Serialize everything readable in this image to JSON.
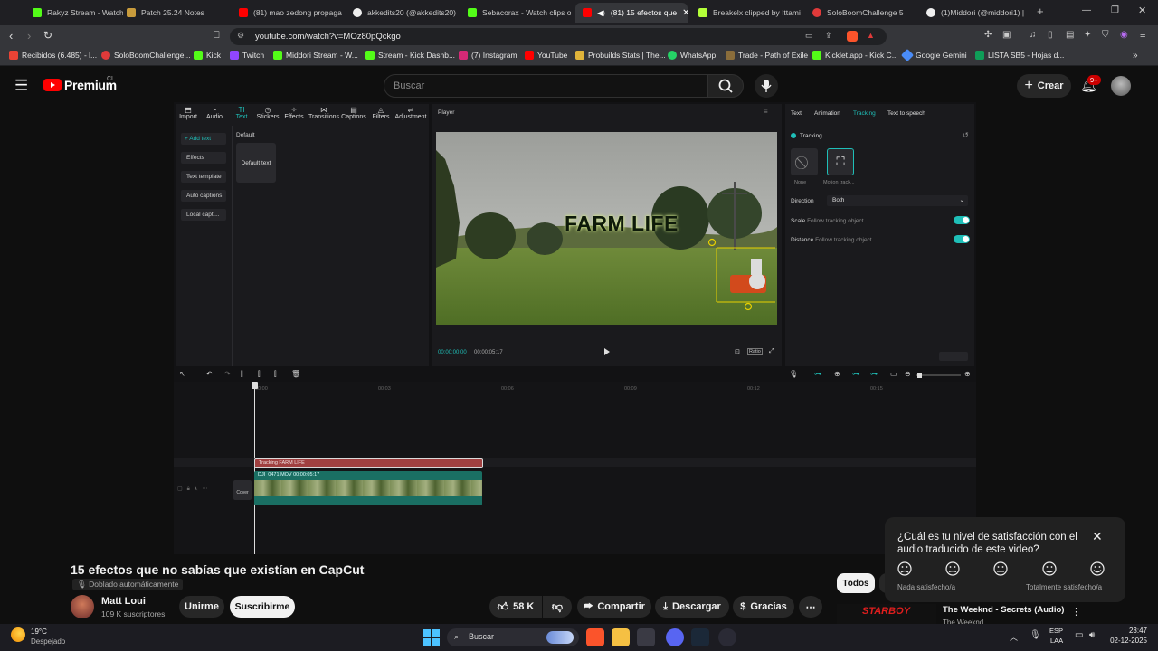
{
  "browser": {
    "tabs": [
      {
        "label": "Rakyz Stream - Watch",
        "color": "#53fc18"
      },
      {
        "label": "Patch 25.24 Notes",
        "color": "#c89b3c"
      },
      {
        "label": "(81) mao zedong propaga",
        "color": "#ff0000"
      },
      {
        "label": "akkedits20 (@akkedits20)",
        "color": "#ffffff"
      },
      {
        "label": "Sebacorax - Watch clips o",
        "color": "#53fc18"
      },
      {
        "label": "(81) 15 efectos que",
        "color": "#ff0000",
        "active": true
      },
      {
        "label": "Breakelx clipped by Ittami",
        "color": "#b4ff39"
      },
      {
        "label": "SoloBoomChallenge 5",
        "color": "#e03a3a"
      },
      {
        "label": "(1)Middori (@middori1) |",
        "color": "#ffffff"
      }
    ],
    "new_tab": "+",
    "url": "youtube.com/watch?v=MOz80pQckgo",
    "bookmarks": [
      "Recibidos (6.485) - l...",
      "SoloBoomChallenge...",
      "Kick",
      "Twitch",
      "Middori Stream - W...",
      "Stream - Kick Dashb...",
      "(7) Instagram",
      "YouTube",
      "Probuilds Stats | The...",
      "WhatsApp",
      "Trade - Path of Exile",
      "Kicklet.app - Kick C...",
      "Google Gemini",
      "LISTA SB5 - Hojas d..."
    ]
  },
  "youtube": {
    "logo": "Premium",
    "country": "CL",
    "search_placeholder": "Buscar",
    "create_label": "Crear",
    "notif_count": "9+",
    "video_title": "15 efectos que no sabías que existían en CapCut",
    "dub_label": "Doblado automáticamente",
    "channel": "Matt Loui",
    "subscribers": "109 K suscriptores",
    "join_label": "Unirme",
    "subscribe_label": "Suscribirme",
    "likes": "58 K",
    "share_label": "Compartir",
    "download_label": "Descargar",
    "thanks_label": "Gracias",
    "chip_label": "Todos",
    "suggested_title": "The Weeknd - Secrets (Audio)",
    "suggested_channel": "The Weeknd",
    "survey": {
      "question": "¿Cuál es tu nivel de satisfacción con el audio traducido de este video?",
      "low_label": "Nada satisfecho/a",
      "high_label": "Totalmente satisfecho/a"
    }
  },
  "capcut": {
    "toolbar": [
      "Import",
      "Audio",
      "Text",
      "Stickers",
      "Effects",
      "Transitions",
      "Captions",
      "Filters",
      "Adjustment"
    ],
    "left_menu": [
      "+ Add text",
      "Effects",
      "Text template",
      "Auto captions",
      "Local capti..."
    ],
    "default_header": "Default",
    "default_text": "Default text",
    "player_label": "Player",
    "overlay_text": "FARM LIFE",
    "time_current": "00:00:00:00",
    "time_total": "00:00:05:17",
    "ratio_label": "Ratio",
    "right_tabs": [
      "Text",
      "Animation",
      "Tracking",
      "Text to speech"
    ],
    "tracking_label": "Tracking",
    "none_label": "None",
    "motion_label": "Motion track...",
    "direction_label": "Direction",
    "direction_value": "Both",
    "scale_label": "Scale",
    "scale_hint": "Follow tracking object",
    "distance_label": "Distance",
    "distance_hint": "Follow tracking object",
    "ruler": [
      "00:00",
      "00:03",
      "00:06",
      "00:09",
      "00:12",
      "00:15"
    ],
    "text_clip": "Tracking  FARM LIFE",
    "video_clip": "DJI_0471.MOV  00:00:05:17",
    "cover_label": "Cover",
    "accent": "#1fbfb8"
  },
  "taskbar": {
    "temp": "19°C",
    "weather": "Despejado",
    "search": "Buscar",
    "lang": "ESP",
    "lang2": "LAA",
    "time": "23:47",
    "date": "02-12-2025"
  }
}
